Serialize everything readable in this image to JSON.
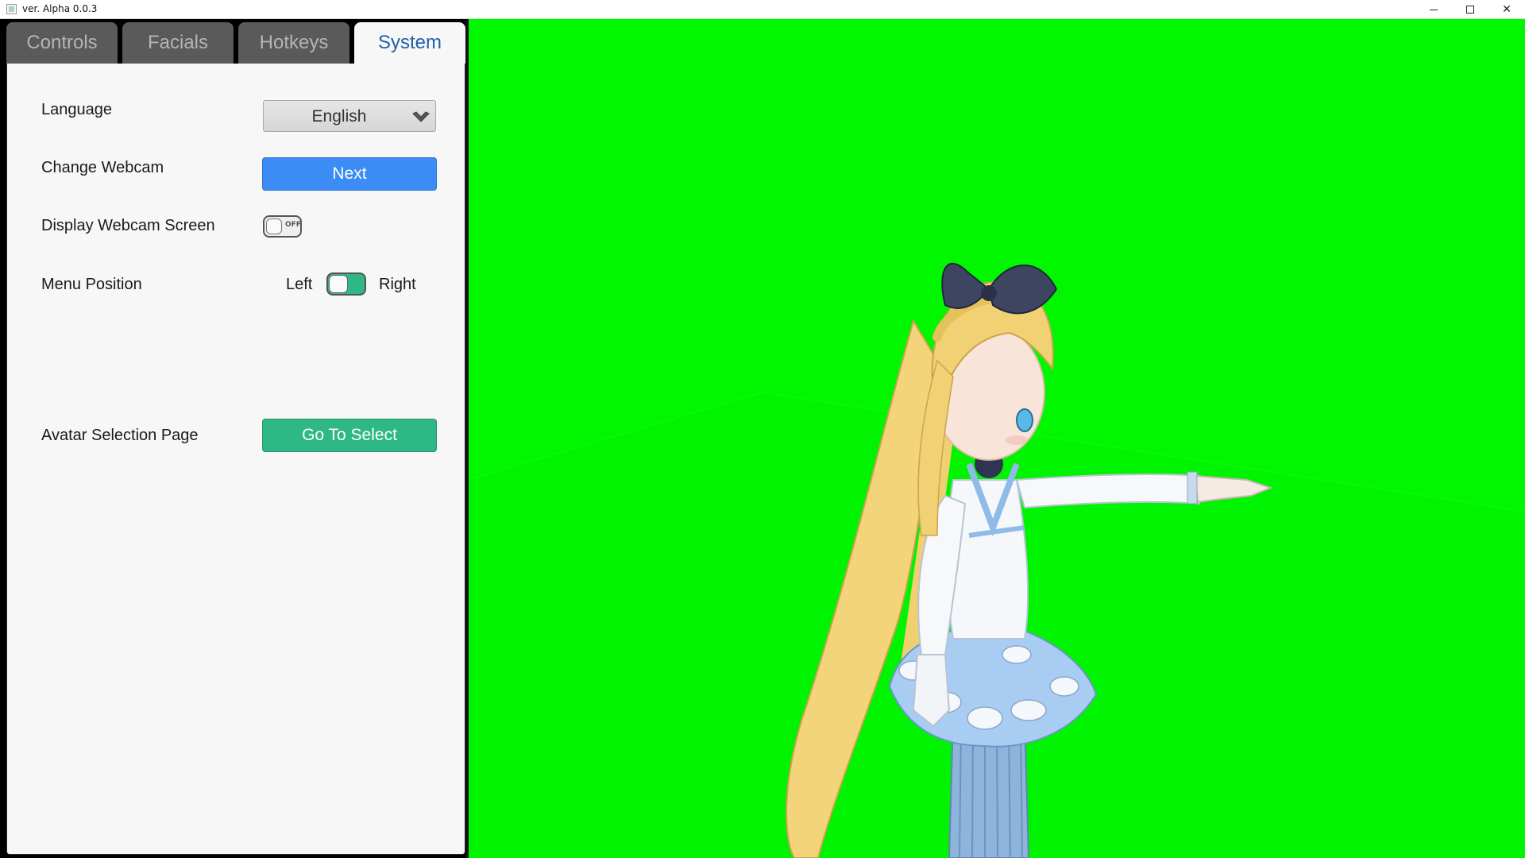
{
  "window": {
    "title": "ver. Alpha 0.0.3",
    "controls": [
      "minimize",
      "maximize",
      "close"
    ],
    "close_glyph": "✕"
  },
  "tabs": [
    {
      "label": "Controls",
      "active": false
    },
    {
      "label": "Facials",
      "active": false
    },
    {
      "label": "Hotkeys",
      "active": false
    },
    {
      "label": "System",
      "active": true
    }
  ],
  "system": {
    "language": {
      "label": "Language",
      "value": "English"
    },
    "webcam": {
      "label": "Change Webcam",
      "button": "Next"
    },
    "display_webcam": {
      "label": "Display Webcam Screen",
      "state": "OFF"
    },
    "menu_position": {
      "label": "Menu Position",
      "left": "Left",
      "right": "Right",
      "selected": "Right"
    },
    "avatar": {
      "label": "Avatar Selection Page",
      "button": "Go To Select"
    }
  },
  "colors": {
    "viewport_background": "#00f700",
    "primary_button": "#3b8cf4",
    "success_button": "#2eb886",
    "active_tab_text": "#1f5fae"
  },
  "icons": [
    "app-icon",
    "chevron-down-icon",
    "minimize-icon",
    "maximize-icon",
    "close-icon"
  ]
}
